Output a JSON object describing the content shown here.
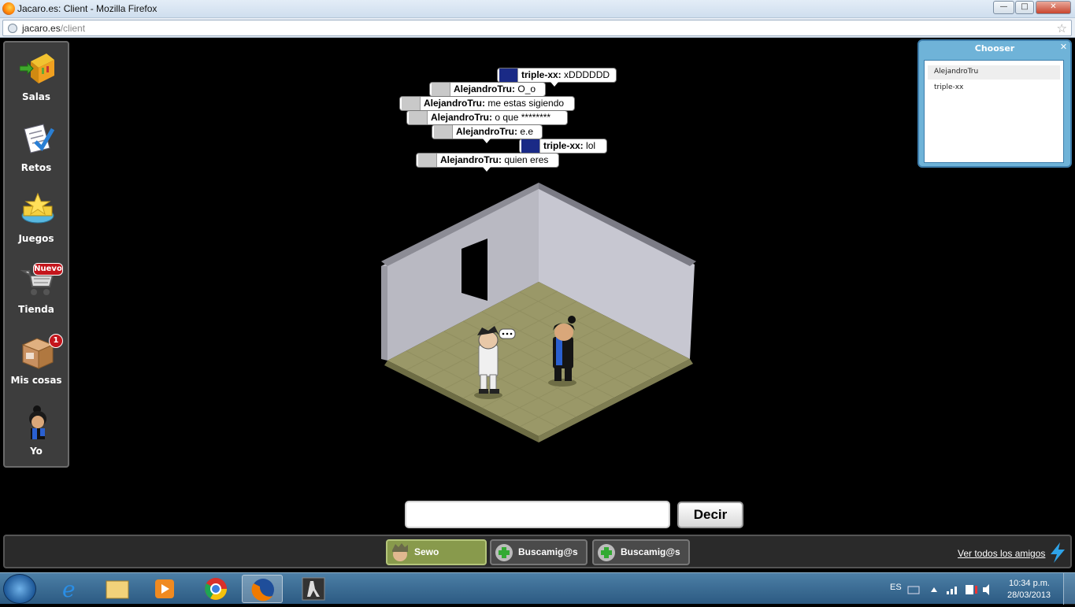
{
  "browser": {
    "window_title": "Jacaro.es: Client - Mozilla Firefox",
    "url_domain": "jacaro.es",
    "url_path": "/client"
  },
  "sidebar": {
    "items": [
      {
        "label": "Salas",
        "icon": "rooms-icon"
      },
      {
        "label": "Retos",
        "icon": "quests-icon"
      },
      {
        "label": "Juegos",
        "icon": "games-icon"
      },
      {
        "label": "Tienda",
        "icon": "shop-icon",
        "badge": "Nuevo"
      },
      {
        "label": "Mis cosas",
        "icon": "inventory-icon",
        "badge": "1"
      },
      {
        "label": "Yo",
        "icon": "avatar-icon"
      }
    ]
  },
  "chat": {
    "bubbles": [
      {
        "user": "triple-xx:",
        "text": "xDDDDDD"
      },
      {
        "user": "AlejandroTru:",
        "text": "O_o"
      },
      {
        "user": "AlejandroTru:",
        "text": "me estas sigiendo"
      },
      {
        "user": "AlejandroTru:",
        "text": "o que ********"
      },
      {
        "user": "AlejandroTru:",
        "text": "e.e"
      },
      {
        "user": "triple-xx:",
        "text": "lol"
      },
      {
        "user": "AlejandroTru:",
        "text": "quien eres"
      }
    ],
    "typing_indicator": "...",
    "input_value": "",
    "send_label": "Decir"
  },
  "chooser": {
    "title": "Chooser",
    "items": [
      "AlejandroTru",
      "triple-xx"
    ]
  },
  "friendsbar": {
    "friends": [
      {
        "name": "Sewo"
      },
      {
        "name": "Buscamig@s"
      },
      {
        "name": "Buscamig@s"
      }
    ],
    "view_all_label": "Ver todos los amigos"
  },
  "taskbar": {
    "language": "ES",
    "time": "10:34 p.m.",
    "date": "28/03/2013"
  },
  "colors": {
    "floor": "#9a9868",
    "wall_left": "#b8b8c0",
    "wall_right": "#c6c6d0",
    "friend_active": "#889a4c",
    "badge": "#c4151c"
  }
}
